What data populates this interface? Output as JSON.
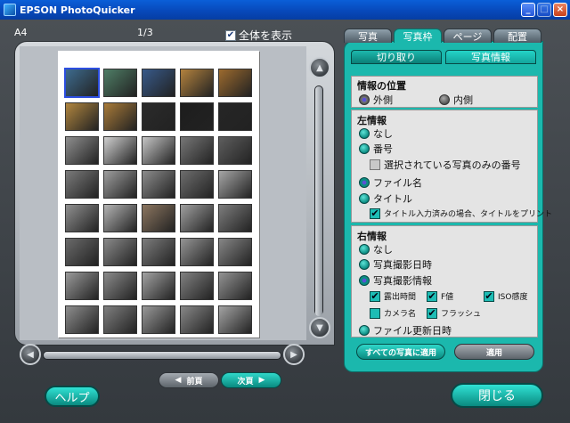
{
  "window": {
    "title": "EPSON PhotoQuicker"
  },
  "preview": {
    "paper_size": "A4",
    "page_indicator": "1/3",
    "show_all_label": "全体を表示",
    "show_all_checked": true,
    "thumb_colors": [
      "#3d6b8f",
      "#4f7e66",
      "#385a8a",
      "#b3823e",
      "#9c6a2e",
      "#b1863f",
      "#a97b39",
      "#2b2b2b",
      "#1d1d1d",
      "#262626",
      "#8f8f8f",
      "#d0d0d0",
      "#c6c6c6",
      "#777777",
      "#5e5e5e",
      "#7a7a7a",
      "#9e9e9e",
      "#8c8c8c",
      "#6d6d6d",
      "#a6a6a6",
      "#909090",
      "#b4b4b4",
      "#8c7660",
      "#a0a0a0",
      "#7d7d7d",
      "#6a6a6a",
      "#8a8a8a",
      "#7c7c7c",
      "#959595",
      "#868686",
      "#9a9a9a",
      "#8b8b8b",
      "#a2a2a2",
      "#818181",
      "#939393",
      "#8e8e8e",
      "#7f7f7f",
      "#999999",
      "#888888",
      "#a4a4a4"
    ],
    "prev_label": "前頁",
    "next_label": "次頁"
  },
  "tabs": [
    {
      "label": "写真",
      "active": false
    },
    {
      "label": "写真枠",
      "active": true
    },
    {
      "label": "ページ",
      "active": false
    },
    {
      "label": "配置",
      "active": false
    }
  ],
  "subtabs": [
    {
      "label": "切り取り",
      "active": false
    },
    {
      "label": "写真情報",
      "active": true
    }
  ],
  "position": {
    "heading": "情報の位置",
    "outside": "外側",
    "inside": "内側"
  },
  "left_info": {
    "heading": "左情報",
    "none": "なし",
    "number": "番号",
    "selected_only": "選択されている写真のみの番号",
    "filename": "ファイル名",
    "title": "タイトル",
    "print_title": "タイトル入力済みの場合、タイトルをプリント"
  },
  "right_info": {
    "heading": "右情報",
    "none": "なし",
    "shot_date": "写真撮影日時",
    "shot_info": "写真撮影情報",
    "exposure": "露出時間",
    "fvalue": "F値",
    "iso": "ISO感度",
    "camera": "カメラ名",
    "flash": "フラッシュ",
    "file_date": "ファイル更新日時"
  },
  "buttons": {
    "apply_all": "すべての写真に適用",
    "apply": "適用",
    "help": "ヘルプ",
    "close": "閉じる"
  }
}
